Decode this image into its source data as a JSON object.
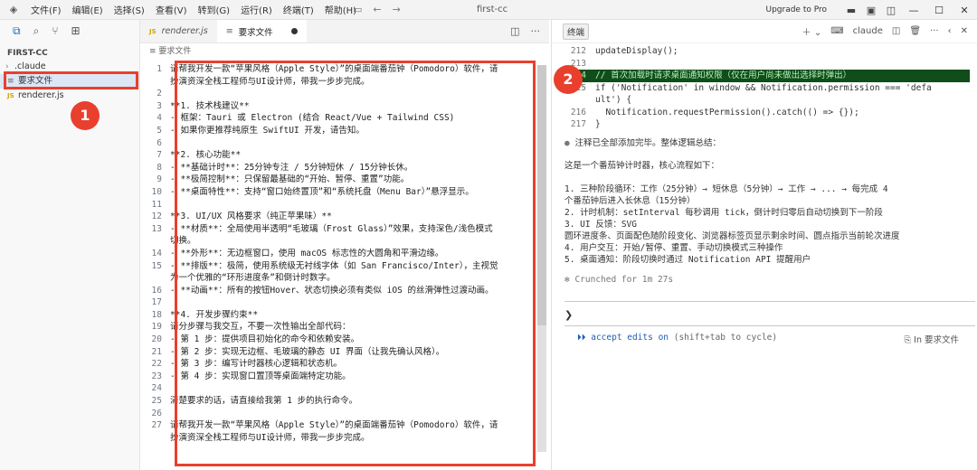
{
  "menu": [
    "文件(F)",
    "编辑(E)",
    "选择(S)",
    "查看(V)",
    "转到(G)",
    "运行(R)",
    "终端(T)",
    "帮助(H)"
  ],
  "window_title": "first-cc",
  "upgrade_label": "Upgrade to Pro",
  "explorer": {
    "section": "FIRST-CC",
    "items": [
      ".claude",
      "要求文件",
      "renderer.js"
    ]
  },
  "editor": {
    "tabs": [
      "renderer.js",
      "要求文件"
    ],
    "breadcrumb": "要求文件",
    "lines": [
      {
        "n": "1",
        "t": "请帮我开发一款“苹果风格（Apple Style）”的桌面端番茄钟（Pomodoro）软件，请"
      },
      {
        "n": "",
        "t": "扮演资深全栈工程师与UI设计师，带我一步步完成。"
      },
      {
        "n": "2",
        "t": ""
      },
      {
        "n": "3",
        "t": "**1. 技术栈建议**"
      },
      {
        "n": "4",
        "t": "- 框架：Tauri 或 Electron (结合 React/Vue + Tailwind CSS)"
      },
      {
        "n": "5",
        "t": "- 如果你更推荐纯原生 SwiftUI 开发，请告知。"
      },
      {
        "n": "6",
        "t": ""
      },
      {
        "n": "7",
        "t": "**2. 核心功能**"
      },
      {
        "n": "8",
        "t": "- **基础计时**：25分钟专注 / 5分钟短休 / 15分钟长休。"
      },
      {
        "n": "9",
        "t": "- **极简控制**：只保留最基础的“开始、暂停、重置”功能。"
      },
      {
        "n": "10",
        "t": "- **桌面特性**：支持“窗口始终置顶”和“系统托盘（Menu Bar）”悬浮显示。"
      },
      {
        "n": "11",
        "t": ""
      },
      {
        "n": "12",
        "t": "**3. UI/UX 风格要求（纯正苹果味）**"
      },
      {
        "n": "13",
        "t": "- **材质**：全局使用半透明“毛玻璃（Frost Glass）”效果，支持深色/浅色模式"
      },
      {
        "n": "",
        "t": "切换。"
      },
      {
        "n": "14",
        "t": "- **外形**：无边框窗口，使用 macOS 标志性的大圆角和平滑边缘。"
      },
      {
        "n": "15",
        "t": "- **排版**：极简，使用系统级无衬线字体（如 San Francisco/Inter），主视觉"
      },
      {
        "n": "",
        "t": "为一个优雅的“环形进度条”和倒计时数字。"
      },
      {
        "n": "16",
        "t": "- **动画**：所有的按钮Hover、状态切换必须有类似 iOS 的丝滑弹性过渡动画。"
      },
      {
        "n": "17",
        "t": ""
      },
      {
        "n": "18",
        "t": "**4. 开发步骤约束**"
      },
      {
        "n": "19",
        "t": "请分步骤与我交互，不要一次性输出全部代码："
      },
      {
        "n": "20",
        "t": "- 第 1 步：提供项目初始化的命令和依赖安装。"
      },
      {
        "n": "21",
        "t": "- 第 2 步：实现无边框、毛玻璃的静态 UI 界面（让我先确认风格）。"
      },
      {
        "n": "22",
        "t": "- 第 3 步：编写计时器核心逻辑和状态机。"
      },
      {
        "n": "23",
        "t": "- 第 4 步：实现窗口置顶等桌面端特定功能。"
      },
      {
        "n": "24",
        "t": ""
      },
      {
        "n": "25",
        "t": "清楚要求的话，请直接给我第 1 步的执行命令。"
      },
      {
        "n": "26",
        "t": ""
      },
      {
        "n": "27",
        "t": "请帮我开发一款“苹果风格（Apple Style）”的桌面端番茄钟（Pomodoro）软件，请"
      },
      {
        "n": "",
        "t": "扮演资深全栈工程师与UI设计师，带我一步步完成。"
      }
    ]
  },
  "terminal": {
    "tab_label": "终端",
    "claude_label": "claude",
    "code": [
      {
        "n": "212",
        "t": "updateDisplay();"
      },
      {
        "n": "213",
        "t": ""
      },
      {
        "n": "214 +",
        "t": "// 首次加载时请求桌面通知权限（仅在用户尚未做出选择时弹出）",
        "added": true
      },
      {
        "n": "215",
        "t": "if ('Notification' in window && Notification.permission === 'defa"
      },
      {
        "n": "",
        "t": "ult') {"
      },
      {
        "n": "216",
        "t": "  Notification.requestPermission().catch(() => {});"
      },
      {
        "n": "217",
        "t": "}"
      }
    ],
    "summary_head": "注释已全部添加完毕。整体逻辑总结：",
    "intro": "这是一个番茄钟计时器，核心流程如下：",
    "points": [
      "1. 三种阶段循环：工作（25分钟）→ 短休息（5分钟）→ 工作 → ... → 每完成 4",
      "个番茄钟后进入长休息（15分钟）",
      "2. 计时机制：setInterval 每秒调用 tick，倒计时归零后自动切换到下一阶段",
      "3. UI 反馈：SVG",
      "圆环进度条、页面配色随阶段变化、浏览器标签页显示剩余时间、圆点指示当前轮次进度",
      "4. 用户交互：开始/暂停、重置、手动切换模式三种操作",
      "5. 桌面通知：阶段切换时通过 Notification API 提醒用户"
    ],
    "crunched": "✻ Crunched for 1m 27s",
    "prompt": "❯",
    "status_left_a": "⏵⏵ accept edits on",
    "status_left_b": " (shift+tab to cycle)",
    "status_right": "In 要求文件"
  },
  "badges": [
    "1",
    "2"
  ]
}
